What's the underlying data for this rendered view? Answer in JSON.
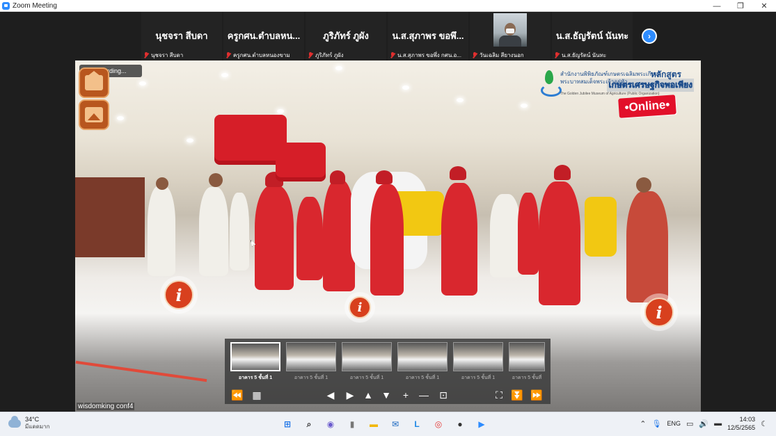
{
  "window": {
    "title": "Zoom Meeting",
    "minimize": "—",
    "restore": "❐",
    "close": "✕"
  },
  "participants": [
    {
      "display": "นุชจรา สีบดา",
      "label": "นุชจรา สีบดา",
      "video": false
    },
    {
      "display": "ครูกศน.ตำบลหน...",
      "label": "ครูกศน.ตำบลหนองขาม",
      "video": false
    },
    {
      "display": "ภูริภัทร์ ภูผัง",
      "label": "ภูริภัทร์ ภูผัง",
      "video": false
    },
    {
      "display": "น.ส.สุภาพร ขอพึ...",
      "label": "น.ส.สุภาพร ขอพึ่ง กศน.อ...",
      "video": false
    },
    {
      "display": "",
      "label": "วันเฉลิม สียางนอก",
      "video": true
    },
    {
      "display": "น.ส.ธัญรัตน์ นันทะ",
      "label": "น.ส.ธัญรัตน์ นันทะ",
      "video": false
    }
  ],
  "next_icon": "›",
  "share": {
    "recording": "Recording...",
    "brand": {
      "org_line1": "สำนักงานพิพิธภัณฑ์เกษตรเฉลิมพระเกียรติ",
      "org_line2": "พระบาทสมเด็จพระเจ้าอยู่หัว",
      "course_line1": "หลักสูตร",
      "course_line2": "เกษตรเศรษฐกิจพอเพียง",
      "english": "The Golden Jubilee Museum of Agriculture (Public Organization)",
      "online": "•Online•"
    },
    "info_glyph": "i",
    "watermark": "wisdomking conf4"
  },
  "tour": {
    "thumbnails": [
      {
        "label": "อาคาร 5 ชั้นที่ 1",
        "active": true
      },
      {
        "label": "อาคาร 5 ชั้นที่ 1",
        "active": false
      },
      {
        "label": "อาคาร 5 ชั้นที่ 1",
        "active": false
      },
      {
        "label": "อาคาร 5 ชั้นที่ 1",
        "active": false
      },
      {
        "label": "อาคาร 5 ชั้นที่ 1",
        "active": false
      },
      {
        "label": "อาคาร 5 ชั้นที่",
        "active": false
      }
    ],
    "controls": {
      "rewind": "⏪",
      "grid": "▦",
      "left": "◀",
      "right": "▶",
      "up": "▲",
      "down": "▼",
      "zoom_in": "+",
      "zoom_out": "—",
      "vr": "⊡",
      "fullscreen": "⛶",
      "hide": "⏬",
      "forward": "⏩"
    }
  },
  "taskbar": {
    "weather_temp": "34°C",
    "weather_desc": "มีแดดมาก",
    "lang": "ENG",
    "time": "14:03",
    "date": "12/5/2565",
    "apps": [
      {
        "name": "start-icon",
        "glyph": "⊞",
        "color": "#1a73e8"
      },
      {
        "name": "search-icon",
        "glyph": "⌕",
        "color": "#333333"
      },
      {
        "name": "chat-icon",
        "glyph": "◉",
        "color": "#6a5acd"
      },
      {
        "name": "device-icon",
        "glyph": "▮",
        "color": "#777777"
      },
      {
        "name": "folder-icon",
        "glyph": "▬",
        "color": "#f2b705"
      },
      {
        "name": "mail-icon",
        "glyph": "✉",
        "color": "#1565c0"
      },
      {
        "name": "line-icon",
        "glyph": "L",
        "color": "#1e88e5"
      },
      {
        "name": "chrome-icon",
        "glyph": "◎",
        "color": "#e53935"
      },
      {
        "name": "media-icon",
        "glyph": "●",
        "color": "#333333"
      },
      {
        "name": "zoom-icon",
        "glyph": "▶",
        "color": "#2d8cff"
      }
    ]
  }
}
